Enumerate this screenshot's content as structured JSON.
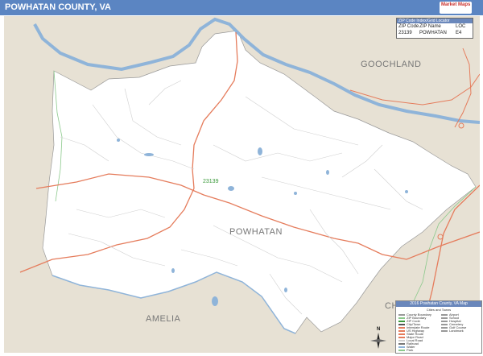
{
  "title": "POWHATAN COUNTY, VA",
  "logo_text": "Market Maps",
  "place_labels": {
    "goochland": "GOOCHLAND",
    "powhatan": "POWHATAN",
    "amelia": "AMELIA",
    "partial_right": "CH"
  },
  "zip_badge": "23139",
  "zip_lookup": {
    "header": "ZIP Code Index/Grid Locator",
    "columns": [
      "ZIP Code",
      "ZIP Name",
      "LOC"
    ],
    "rows": [
      [
        "23139",
        "POWHATAN",
        "E4"
      ]
    ]
  },
  "legend": {
    "title": "2016 Powhatan County, VA Map",
    "subtitle": "Cities and Towns",
    "left_items": [
      "County Boundary",
      "ZIP Boundary",
      "ZIP Code",
      "City/Town",
      "Interstate Route",
      "US Highway",
      "State Route",
      "Major Road",
      "Local Road",
      "Railroad",
      "Water",
      "Park"
    ],
    "right_items": [
      "Airport",
      "School",
      "Hospital",
      "Cemetery",
      "Golf Course",
      "Landmark"
    ]
  },
  "colors": {
    "title_bar": "#5b85c2",
    "land": "#ffffff",
    "outside": "#e7e1d4",
    "river": "#8fb4d9",
    "major_road": "#e57c5c",
    "zip_boundary": "#8bc98b",
    "local_road": "#d0d0d0"
  },
  "compass_letter": "N"
}
